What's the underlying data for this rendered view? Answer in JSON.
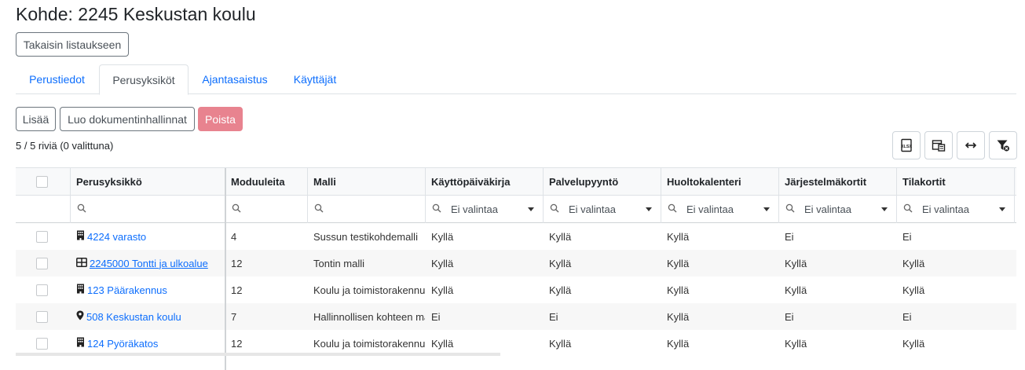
{
  "page": {
    "title": "Kohde: 2245 Keskustan koulu"
  },
  "back_button": "Takaisin listaukseen",
  "tabs": [
    {
      "label": "Perustiedot",
      "active": false
    },
    {
      "label": "Perusyksiköt",
      "active": true
    },
    {
      "label": "Ajantasaistus",
      "active": false
    },
    {
      "label": "Käyttäjät",
      "active": false
    }
  ],
  "actions": {
    "add": "Lisää",
    "create_docs": "Luo dokumentinhallinnat",
    "delete": "Poista"
  },
  "row_count": "5 / 5 riviä (0 valittuna)",
  "toolbar_icons": [
    "export-xlsx-icon",
    "column-chooser-icon",
    "fit-columns-icon",
    "clear-filter-icon"
  ],
  "grid": {
    "columns": [
      "Perusyksikkö",
      "Moduuleita",
      "Malli",
      "Käyttöpäiväkirja",
      "Palvelupyyntö",
      "Huoltokalenteri",
      "Järjestelmäkortit",
      "Tilakortit"
    ],
    "filter_placeholder": "Ei valintaa",
    "rows": [
      {
        "icon": "building-icon",
        "unit": "4224 varasto",
        "modules": "4",
        "model": "Sussun testikohdemalli",
        "kpk": "Kyllä",
        "pp": "Kyllä",
        "hk": "Kyllä",
        "jk": "Ei",
        "tk": "Ei",
        "underline": false
      },
      {
        "icon": "grid-icon",
        "unit": "2245000 Tontti ja ulkoalue",
        "modules": "12",
        "model": "Tontin malli",
        "kpk": "Kyllä",
        "pp": "Kyllä",
        "hk": "Kyllä",
        "jk": "Kyllä",
        "tk": "Kyllä",
        "underline": true
      },
      {
        "icon": "building-icon",
        "unit": "123 Päärakennus",
        "modules": "12",
        "model": "Koulu ja toimistorakennus",
        "kpk": "Kyllä",
        "pp": "Kyllä",
        "hk": "Kyllä",
        "jk": "Kyllä",
        "tk": "Kyllä",
        "underline": false
      },
      {
        "icon": "map-pin-icon",
        "unit": "508 Keskustan koulu",
        "modules": "7",
        "model": "Hallinnollisen kohteen malli",
        "kpk": "Ei",
        "pp": "Ei",
        "hk": "Kyllä",
        "jk": "Ei",
        "tk": "Ei",
        "underline": false
      },
      {
        "icon": "building-icon",
        "unit": "124 Pyöräkatos",
        "modules": "12",
        "model": "Koulu ja toimistorakennus",
        "kpk": "Kyllä",
        "pp": "Kyllä",
        "hk": "Kyllä",
        "jk": "Kyllä",
        "tk": "Kyllä",
        "underline": false
      }
    ]
  }
}
